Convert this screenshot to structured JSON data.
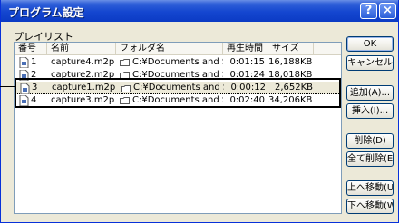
{
  "dialog": {
    "title": "プログラム設定",
    "help_glyph": "?",
    "close_glyph": "×"
  },
  "playlist": {
    "label": "プレイリスト",
    "columns": [
      "番号",
      "名前",
      "フォルダ名",
      "再生時間",
      "サイズ"
    ],
    "rows": [
      {
        "num": "1",
        "name": "capture4.m2p",
        "folder": "C:¥Documents and Set...",
        "duration": "0:01:15",
        "size": "16,188KB",
        "icon": "file-icon"
      },
      {
        "num": "2",
        "name": "capture2.m2p",
        "folder": "C:¥Documents and Set...",
        "duration": "0:01:24",
        "size": "18,018KB",
        "icon": "file-icon"
      },
      {
        "num": "3",
        "name": "capture1.m2p",
        "folder": "C:¥Documents and Set...",
        "duration": "0:00:12",
        "size": "2,652KB",
        "icon": "file-icon"
      },
      {
        "num": "4",
        "name": "capture3.m2p",
        "folder": "C:¥Documents and Set...",
        "duration": "0:02:40",
        "size": "34,206KB",
        "icon": "file-icon"
      }
    ],
    "selected_row": 3
  },
  "buttons": {
    "ok": "OK",
    "cancel": "キャンセル",
    "add": "追加(A)...",
    "insert": "挿入(I)...",
    "delete": "削除(D)",
    "delete_all": "全て削除(E)",
    "move_up": "上へ移動(U)",
    "move_down": "下へ移動(W)"
  },
  "colors": {
    "titlebar": "#0b3bc4",
    "dialog_bg": "#ece9d8",
    "list_border": "#7f9db9"
  }
}
